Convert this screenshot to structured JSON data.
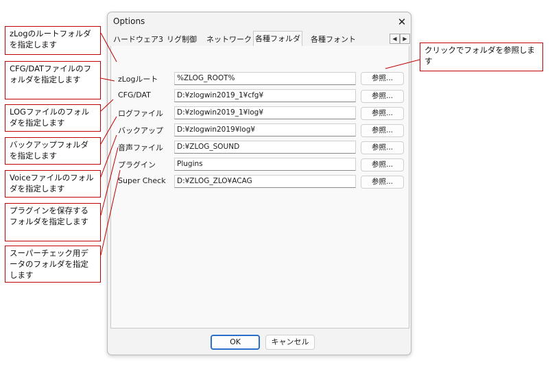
{
  "dialog": {
    "title": "Options",
    "close_glyph": "✕",
    "tabs": [
      {
        "label": "ハードウェア3"
      },
      {
        "label": "リグ制御"
      },
      {
        "label": "ネットワーク"
      },
      {
        "label": "各種フォルダ",
        "active": true
      },
      {
        "label": "各種フォント"
      }
    ],
    "tab_scroll": {
      "left": "◀",
      "right": "▶"
    },
    "rows": [
      {
        "label": "zLogルート",
        "value": "%ZLOG_ROOT%",
        "button": "参照..."
      },
      {
        "label": "CFG/DAT",
        "value": "D:¥zlogwin2019_1¥cfg¥",
        "button": "参照..."
      },
      {
        "label": "ログファイル",
        "value": "D:¥zlogwin2019_1¥log¥",
        "button": "参照..."
      },
      {
        "label": "バックアップ",
        "value": "D:¥zlogwin2019¥log¥",
        "button": "参照..."
      },
      {
        "label": "音声ファイル",
        "value": "D:¥ZLOG_SOUND",
        "button": "参照..."
      },
      {
        "label": "プラグイン",
        "value": "Plugins",
        "button": "参照..."
      },
      {
        "label": "Super Check",
        "value": "D:¥ZLOG_ZLO¥ACAG",
        "button": "参照..."
      }
    ],
    "ok_label": "OK",
    "cancel_label": "キャンセル"
  },
  "callouts": {
    "zlog_root": "zLogのルートフォルダを指定します",
    "cfg_dat": "CFG/DATファイルのフォルダを指定します",
    "log_file": "LOGファイルのフォルダを指定します",
    "backup": "バックアップフォルダを指定します",
    "voice": "Voiceファイルのフォルダを指定します",
    "plugin": "プラグインを保存するフォルダを指定します",
    "super_check": "スーパーチェック用データのフォルダを指定します",
    "browse": "クリックでフォルダを参照します"
  },
  "colors": {
    "callout_border": "#c00000",
    "default_button_border": "#2a6fc9"
  }
}
